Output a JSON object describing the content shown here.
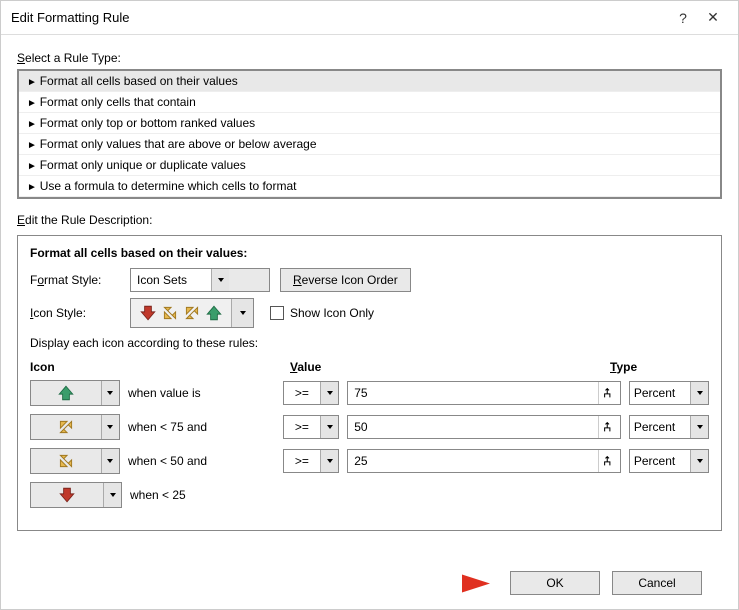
{
  "window": {
    "title": "Edit Formatting Rule",
    "help": "?",
    "close": "✕"
  },
  "labels": {
    "select_rule_type_pre": "S",
    "select_rule_type_post": "elect a Rule Type:",
    "edit_desc_pre": "E",
    "edit_desc_post": "dit the Rule Description:",
    "desc_title": "Format all cells based on their values:",
    "format_style_pre": "F",
    "format_style_post": "ormat Style:",
    "icon_style_pre": "I",
    "icon_style_post": "con Style:",
    "reverse_pre": "R",
    "reverse_post": "everse Icon Order",
    "show_icon_only": "Show Icon Only",
    "display_rules": "Display each icon according to these rules:",
    "col_icon": "Icon",
    "col_value_pre": "V",
    "col_value_post": "alue",
    "col_type_pre": "T",
    "col_type_post": "ype"
  },
  "rule_types": [
    {
      "label": "Format all cells based on their values",
      "selected": true
    },
    {
      "label": "Format only cells that contain",
      "selected": false
    },
    {
      "label": "Format only top or bottom ranked values",
      "selected": false
    },
    {
      "label": "Format only values that are above or below average",
      "selected": false
    },
    {
      "label": "Format only unique or duplicate values",
      "selected": false
    },
    {
      "label": "Use a formula to determine which cells to format",
      "selected": false
    }
  ],
  "format_style": "Icon Sets",
  "icon_rules": [
    {
      "when": "when value is",
      "op": ">=",
      "value": "75",
      "type": "Percent",
      "icon": "arrow-up-green"
    },
    {
      "when": "when < 75 and",
      "op": ">=",
      "value": "50",
      "type": "Percent",
      "icon": "arrow-upright-yellow"
    },
    {
      "when": "when < 50 and",
      "op": ">=",
      "value": "25",
      "type": "Percent",
      "icon": "arrow-downright-yellow"
    },
    {
      "when": "when < 25",
      "op": "",
      "value": "",
      "type": "",
      "icon": "arrow-down-red"
    }
  ],
  "footer": {
    "ok": "OK",
    "cancel": "Cancel"
  }
}
